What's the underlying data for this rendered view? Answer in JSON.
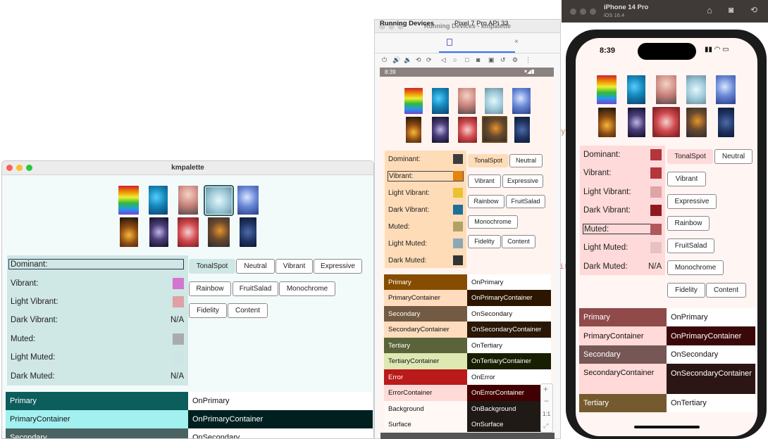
{
  "desktop": {
    "title": "kmpalette",
    "swatch_rows": [
      {
        "label": "Dominant:",
        "value": ""
      },
      {
        "label": "Vibrant:",
        "value": "",
        "color": "#d475d0"
      },
      {
        "label": "Light Vibrant:",
        "value": "",
        "color": "#e0a0a4"
      },
      {
        "label": "Dark Vibrant:",
        "value": "N/A"
      },
      {
        "label": "Muted:",
        "value": "",
        "color": "#a8acaf"
      },
      {
        "label": "Light Muted:",
        "value": "",
        "color": "#cfe4e6"
      },
      {
        "label": "Dark Muted:",
        "value": "N/A"
      }
    ],
    "styles": [
      "TonalSpot",
      "Neutral",
      "Vibrant",
      "Expressive",
      "Rainbow",
      "FruitSalad",
      "Monochrome",
      "Fidelity",
      "Content"
    ],
    "roles": [
      {
        "left": "Primary",
        "right": "OnPrimary"
      },
      {
        "left": "PrimaryContainer",
        "right": "OnPrimaryContainer"
      },
      {
        "left": "Secondary",
        "right": "OnSecondary"
      }
    ]
  },
  "studio": {
    "window_title": "Running Devices - kmpalette",
    "tab_running": "Running Devices",
    "tab_device": "Pixel 7 Pro API 33",
    "status_time": "8:39",
    "swatch_rows": [
      {
        "label": "Dominant:",
        "color": "#3c3c3c"
      },
      {
        "label": "Vibrant:",
        "color": "#e6830f"
      },
      {
        "label": "Light Vibrant:",
        "color": "#eac131"
      },
      {
        "label": "Dark Vibrant:",
        "color": "#1e6f9a"
      },
      {
        "label": "Muted:",
        "color": "#b0a266"
      },
      {
        "label": "Light Muted:",
        "color": "#8aa8b6"
      },
      {
        "label": "Dark Muted:",
        "color": "#333333"
      }
    ],
    "styles": [
      "TonalSpot",
      "Neutral",
      "Vibrant",
      "Expressive",
      "Rainbow",
      "FruitSalad",
      "Monochrome",
      "Fidelity",
      "Content"
    ],
    "roles": [
      {
        "left": "Primary",
        "right": "OnPrimary"
      },
      {
        "left": "PrimaryContainer",
        "right": "OnPrimaryContainer"
      },
      {
        "left": "Secondary",
        "right": "OnSecondary"
      },
      {
        "left": "SecondaryContainer",
        "right": "OnSecondaryContainer"
      },
      {
        "left": "Tertiary",
        "right": "OnTertiary"
      },
      {
        "left": "TertiaryContainer",
        "right": "OnTertiaryContainer"
      },
      {
        "left": "Error",
        "right": "OnError"
      },
      {
        "left": "ErrorContainer",
        "right": "OnErrorContainer"
      },
      {
        "left": "Background",
        "right": "OnBackground"
      },
      {
        "left": "Surface",
        "right": "OnSurface"
      }
    ],
    "zoom_controls": [
      "+",
      "−",
      "1:1",
      "⤢"
    ]
  },
  "ios": {
    "device_name": "iPhone 14 Pro",
    "os_version": "iOS 16.4",
    "status_time": "8:39",
    "swatch_rows": [
      {
        "label": "Dominant:",
        "value": "",
        "color": "#b3363d"
      },
      {
        "label": "Vibrant:",
        "value": "",
        "color": "#b3363d"
      },
      {
        "label": "Light Vibrant:",
        "value": "",
        "color": "#e0a4a7"
      },
      {
        "label": "Dark Vibrant:",
        "value": "",
        "color": "#8e1a20"
      },
      {
        "label": "Muted:",
        "value": "",
        "color": "#b0585a"
      },
      {
        "label": "Light Muted:",
        "value": "",
        "color": "#e8c2c3"
      },
      {
        "label": "Dark Muted:",
        "value": "N/A"
      }
    ],
    "styles": [
      "TonalSpot",
      "Neutral",
      "Vibrant",
      "Expressive",
      "Rainbow",
      "FruitSalad",
      "Monochrome",
      "Fidelity",
      "Content"
    ],
    "roles": [
      {
        "left": "Primary",
        "right": "OnPrimary"
      },
      {
        "left": "PrimaryContainer",
        "right": "OnPrimaryContainer"
      },
      {
        "left": "Secondary",
        "right": "OnSecondary"
      },
      {
        "left": "SecondaryContainer",
        "right": "OnSecondaryContainer"
      },
      {
        "left": "Tertiary",
        "right": "OnTertiary"
      }
    ]
  },
  "code_fragments": [
    "y",
    "it"
  ]
}
